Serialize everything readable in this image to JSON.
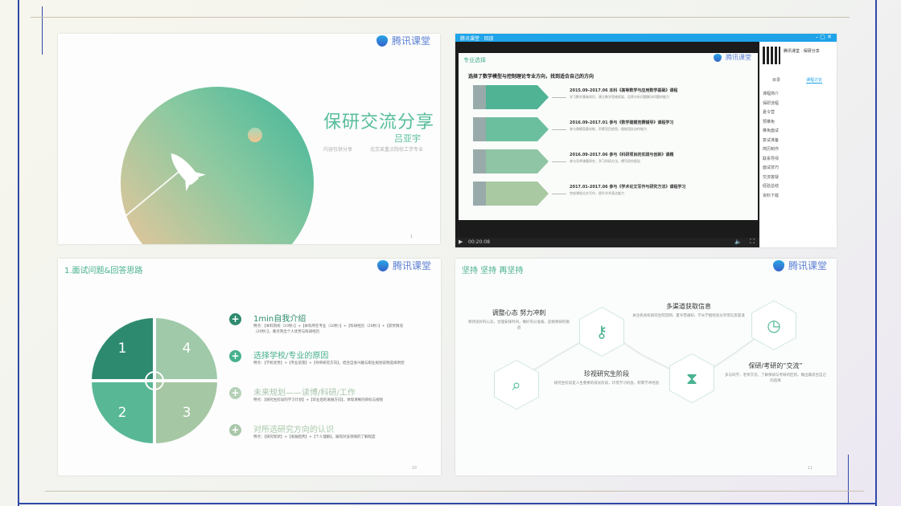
{
  "colors": {
    "accent_green": "#4ab392",
    "dark_green": "#2e8a6f",
    "frame_blue": "#2f49a8",
    "brand_blue": "#5d7fd3"
  },
  "brand": {
    "name": "腾讯课堂",
    "icon": "shield-icon"
  },
  "slide1": {
    "title": "保研交流分享",
    "author": "吕亚宇",
    "meta_left": "内容仅供分享",
    "meta_right": "北京某重点院校工学专业",
    "page_number": "1"
  },
  "slide2": {
    "window_title": "腾讯课堂 · 回放",
    "section": "专业选择",
    "heading": "选择了数学模型与控制理论专业方向，找到适合自己的方向",
    "rows": [
      {
        "num": "01",
        "title": "2015.09-2017.06  本科《高等数学与应用数学基础》课程",
        "desc": "学习数学基础知识，建立数学思维框架，培养分析问题解决问题的能力"
      },
      {
        "num": "02",
        "title": "2016.09-2017.01  参与《数学建模竞赛辅导》课程学习",
        "desc": "参与建模竞赛训练，积累项目经验，锻炼团队协作能力"
      },
      {
        "num": "03",
        "title": "2016.09-2017.06  参与《科研项目的实践与创新》课题",
        "desc": "参与导师课题研究，学习科研方法，撰写研究报告"
      },
      {
        "num": "04",
        "title": "2017.01-2017.06  参与《学术论文写作与研究方法》课程学习",
        "desc": "完成课程论文写作，提升学术表达能力"
      }
    ],
    "sidebar": {
      "course_name": "腾讯课堂 · 保研分享",
      "tabs": [
        "目录",
        "课程讨论"
      ],
      "items": [
        "课程简介",
        "保研流程",
        "夏令营",
        "预推免",
        "推免面试",
        "复试准备",
        "简历制作",
        "联系导师",
        "面试技巧",
        "交流答疑",
        "经验总结",
        "资料下载"
      ]
    },
    "time": "00:20:08"
  },
  "slide3": {
    "title": "1.面试问题&回答思路",
    "quadrants": [
      "1",
      "4",
      "2",
      "3"
    ],
    "items": [
      {
        "heading": "1min自我介绍",
        "desc": "特点：【本科院校（10秒）】+【本科所在专业（10秒）】+【科研经历（20秒）】+【获奖情况（20秒）】，重点突出个人优势与科研经历",
        "icon": "plus-icon"
      },
      {
        "heading": "选择学校/专业的原因",
        "desc": "特点：【学校优势】+【专业前景】+【导师研究方向】，结合自身兴趣与职业规划说明选择原因",
        "icon": "plus-icon"
      },
      {
        "heading": "未来规划——读博/科研/工作",
        "desc": "特点：【研究生阶段的学习计划】+【毕业后的发展方向】，体现清晰的目标与规划",
        "icon": "plus-icon"
      },
      {
        "heading": "对所选研究方向的认识",
        "desc": "特点：【研究现状】+【发展趋势】+【个人理解】，展现对该领域的了解程度",
        "icon": "plus-icon"
      }
    ],
    "page_number": "10"
  },
  "slide4": {
    "title": "坚持 坚持 再坚持",
    "blocks": [
      {
        "heading": "调整心态 努力冲刺",
        "desc": "保持良好的心态，合理安排时间，做好充分准备，迎接保研的挑战"
      },
      {
        "heading": "多渠道获取信息",
        "desc": "关注各高校研究生院官网、夏令营通知、学长学姐经验分享等信息渠道"
      },
      {
        "heading": "珍视研究生阶段",
        "desc": "研究生阶段是人生重要的成长阶段，珍惜学习机会，积累学术经验"
      },
      {
        "heading": "保研/考研的“交流”",
        "desc": "多与同学、老师交流，了解保研与考研的区别，做出最适合自己的选择"
      }
    ],
    "page_number": "11"
  }
}
